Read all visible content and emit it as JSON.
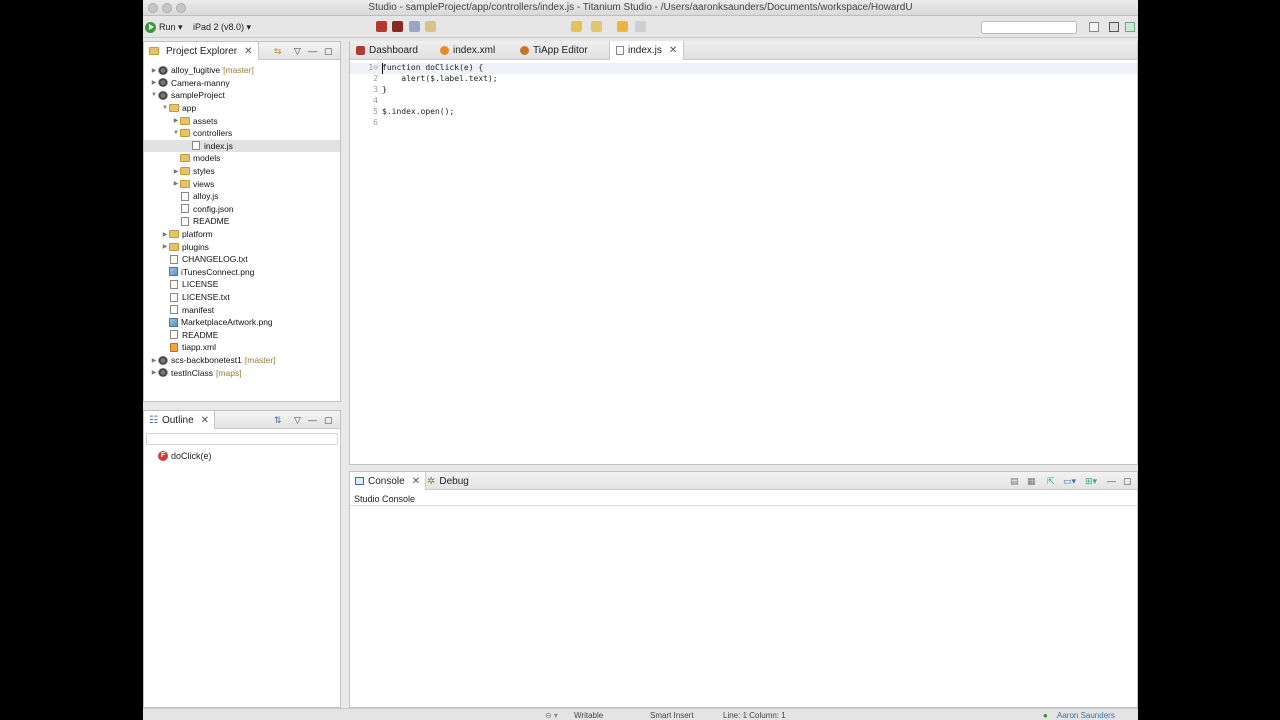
{
  "window": {
    "title": "Studio - sampleProject/app/controllers/index.js - Titanium Studio - /Users/aaronksaunders/Documents/workspace/HowardU"
  },
  "toolbar": {
    "run_label": "Run ▾",
    "target_label": "iPad 2 (v8.0) ▾"
  },
  "project_explorer": {
    "title": "Project Explorer",
    "tree": [
      {
        "label": "alloy_fugitive",
        "branch": "[master]",
        "indent": 0,
        "icon": "project-icon",
        "twisty": "▶"
      },
      {
        "label": "Camera-manny",
        "branch": "",
        "indent": 0,
        "icon": "project-icon",
        "twisty": "▶"
      },
      {
        "label": "sampleProject",
        "branch": "",
        "indent": 0,
        "icon": "project-icon",
        "twisty": "▼"
      },
      {
        "label": "app",
        "branch": "",
        "indent": 1,
        "icon": "folder-icon",
        "twisty": "▼"
      },
      {
        "label": "assets",
        "branch": "",
        "indent": 2,
        "icon": "folder-icon",
        "twisty": "▶"
      },
      {
        "label": "controllers",
        "branch": "",
        "indent": 2,
        "icon": "folder-icon",
        "twisty": "▼"
      },
      {
        "label": "index.js",
        "branch": "",
        "indent": 3,
        "icon": "file-icon",
        "twisty": "",
        "selected": true
      },
      {
        "label": "models",
        "branch": "",
        "indent": 2,
        "icon": "folder-icon",
        "twisty": ""
      },
      {
        "label": "styles",
        "branch": "",
        "indent": 2,
        "icon": "folder-icon",
        "twisty": "▶"
      },
      {
        "label": "views",
        "branch": "",
        "indent": 2,
        "icon": "folder-icon",
        "twisty": "▶"
      },
      {
        "label": "alloy.js",
        "branch": "",
        "indent": 2,
        "icon": "file-icon",
        "twisty": ""
      },
      {
        "label": "config.json",
        "branch": "",
        "indent": 2,
        "icon": "file-icon",
        "twisty": ""
      },
      {
        "label": "README",
        "branch": "",
        "indent": 2,
        "icon": "file-icon",
        "twisty": ""
      },
      {
        "label": "platform",
        "branch": "",
        "indent": 1,
        "icon": "folder-icon",
        "twisty": "▶"
      },
      {
        "label": "plugins",
        "branch": "",
        "indent": 1,
        "icon": "folder-icon",
        "twisty": "▶"
      },
      {
        "label": "CHANGELOG.txt",
        "branch": "",
        "indent": 1,
        "icon": "file-icon",
        "twisty": ""
      },
      {
        "label": "iTunesConnect.png",
        "branch": "",
        "indent": 1,
        "icon": "image-file-icon",
        "twisty": ""
      },
      {
        "label": "LICENSE",
        "branch": "",
        "indent": 1,
        "icon": "file-icon",
        "twisty": ""
      },
      {
        "label": "LICENSE.txt",
        "branch": "",
        "indent": 1,
        "icon": "file-icon",
        "twisty": ""
      },
      {
        "label": "manifest",
        "branch": "",
        "indent": 1,
        "icon": "file-icon",
        "twisty": ""
      },
      {
        "label": "MarketplaceArtwork.png",
        "branch": "",
        "indent": 1,
        "icon": "image-file-icon",
        "twisty": ""
      },
      {
        "label": "README",
        "branch": "",
        "indent": 1,
        "icon": "file-icon",
        "twisty": ""
      },
      {
        "label": "tiapp.xml",
        "branch": "",
        "indent": 1,
        "icon": "xml-file-icon",
        "twisty": ""
      },
      {
        "label": "scs-backbonetest1",
        "branch": "[master]",
        "indent": 0,
        "icon": "project-icon",
        "twisty": "▶"
      },
      {
        "label": "testInClass",
        "branch": "[maps]",
        "indent": 0,
        "icon": "project-icon",
        "twisty": "▶"
      }
    ]
  },
  "outline": {
    "title": "Outline",
    "items": [
      {
        "label": "doClick(e)"
      }
    ]
  },
  "editor": {
    "tabs": [
      {
        "label": "Dashboard",
        "icon": "dashboard-icon",
        "active": false
      },
      {
        "label": "index.xml",
        "icon": "xml-file-icon",
        "active": false
      },
      {
        "label": "TiApp Editor",
        "icon": "tiapp-icon",
        "active": false
      },
      {
        "label": "index.js",
        "icon": "js-file-icon",
        "active": true
      }
    ],
    "lines": [
      {
        "num": "1⊖",
        "text": "function doClick(e) {"
      },
      {
        "num": "2",
        "text": "    alert($.label.text);"
      },
      {
        "num": "3",
        "text": "}"
      },
      {
        "num": "4",
        "text": ""
      },
      {
        "num": "5",
        "text": "$.index.open();"
      },
      {
        "num": "6",
        "text": ""
      }
    ]
  },
  "console_panel": {
    "tabs": [
      {
        "label": "Console",
        "icon": "console-icon",
        "active": true
      },
      {
        "label": "Debug",
        "icon": "debug-icon",
        "active": false
      }
    ],
    "console_name": "Studio Console"
  },
  "statusbar": {
    "writable": "Writable",
    "insert_mode": "Smart Insert",
    "position": "Line: 1 Column: 1",
    "user": "Aaron Saunders"
  },
  "colors": {
    "project_branch": "#9a7b3a",
    "outline_function_icon": "#d23c3c",
    "run_green": "#3a9a3a"
  }
}
